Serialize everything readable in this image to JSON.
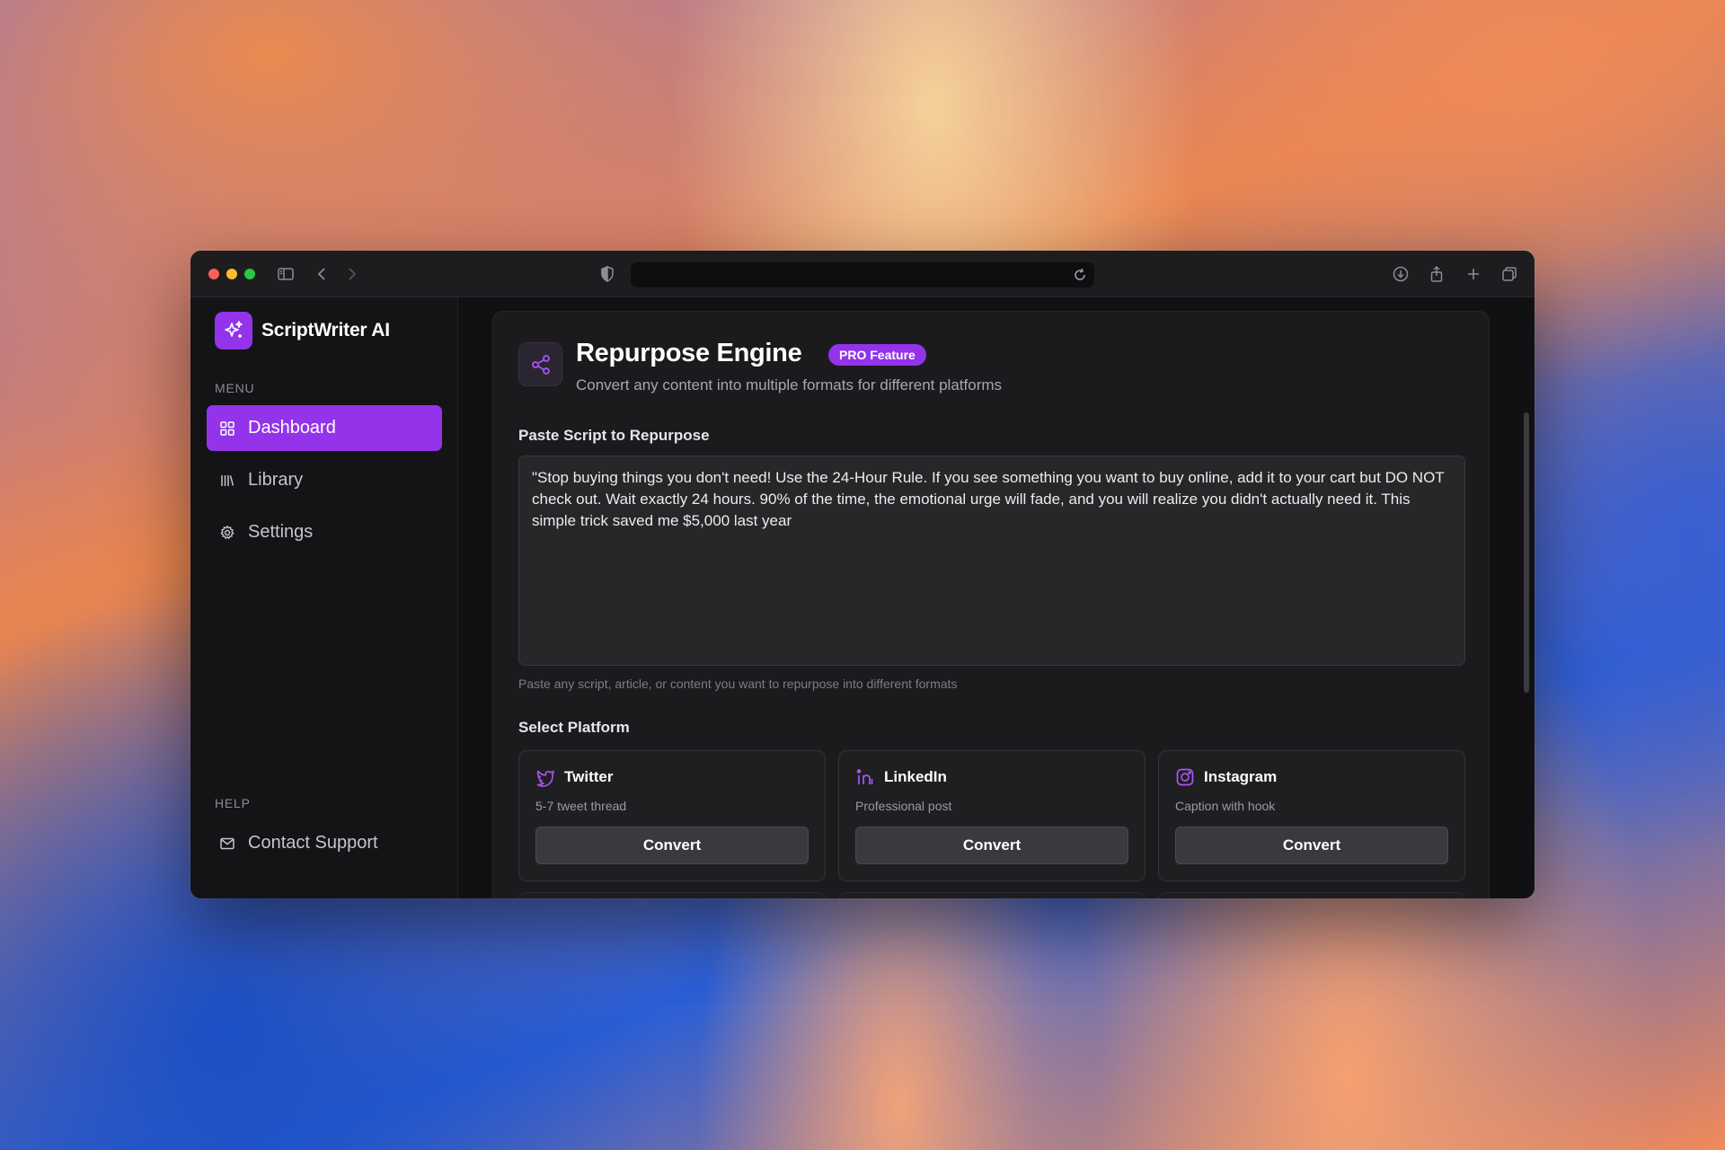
{
  "app": {
    "name": "ScriptWriter AI"
  },
  "sidebar": {
    "menu_label": "MENU",
    "items": [
      {
        "label": "Dashboard",
        "icon": "grid-icon",
        "active": true
      },
      {
        "label": "Library",
        "icon": "library-icon",
        "active": false
      },
      {
        "label": "Settings",
        "icon": "gear-icon",
        "active": false
      }
    ],
    "help_label": "HELP",
    "help_items": [
      {
        "label": "Contact Support",
        "icon": "mail-icon"
      }
    ]
  },
  "main": {
    "title": "Repurpose Engine",
    "badge": "PRO Feature",
    "subtitle": "Convert any content into multiple formats for different platforms",
    "script_label": "Paste Script to Repurpose",
    "script_value": "\"Stop buying things you don't need! Use the 24-Hour Rule. If you see something you want to buy online, add it to your cart but DO NOT check out. Wait exactly 24 hours. 90% of the time, the emotional urge will fade, and you will realize you didn't actually need it. This simple trick saved me $5,000 last year",
    "script_hint": "Paste any script, article, or content you want to repurpose into different formats",
    "platform_label": "Select Platform",
    "platforms": [
      {
        "name": "Twitter",
        "desc": "5-7 tweet thread",
        "button": "Convert",
        "icon": "twitter-icon"
      },
      {
        "name": "LinkedIn",
        "desc": "Professional post",
        "button": "Convert",
        "icon": "linkedin-icon"
      },
      {
        "name": "Instagram",
        "desc": "Caption with hook",
        "button": "Convert",
        "icon": "instagram-icon"
      }
    ]
  },
  "colors": {
    "accent": "#9333ea",
    "background": "#111113",
    "card": "#1b1b1e"
  }
}
